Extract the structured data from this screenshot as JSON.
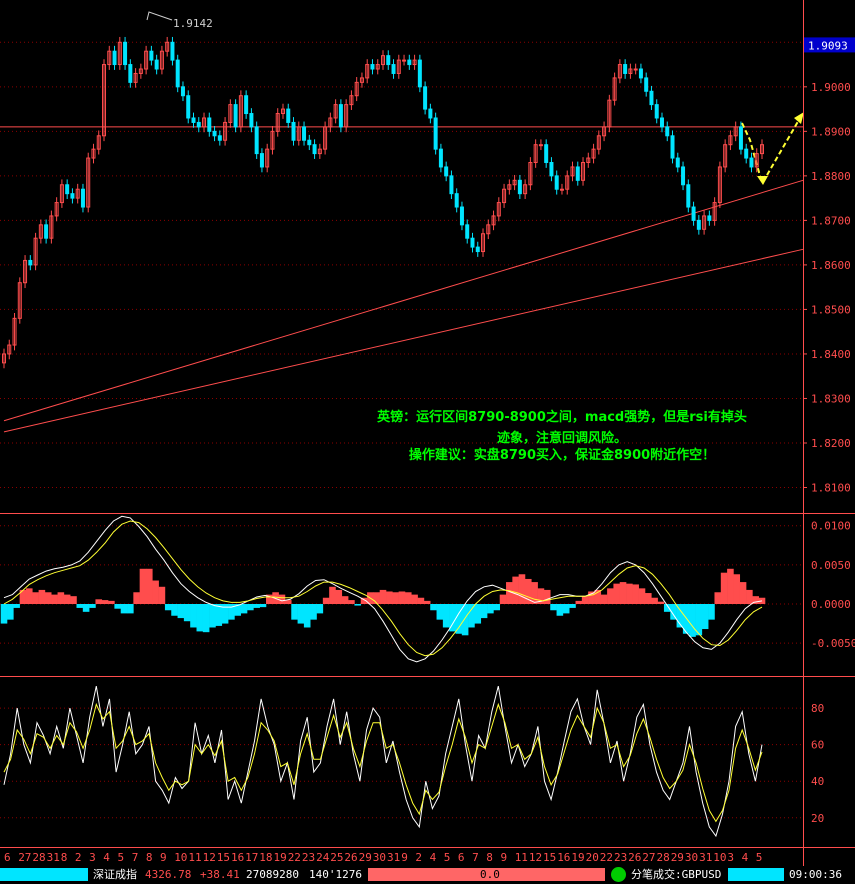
{
  "chart_data": [
    {
      "type": "candlestick",
      "symbol": "GBPUSD",
      "ylim": [
        1.8045,
        1.9195
      ],
      "y_ticks": [
        "1.9100",
        "1.9000",
        "1.8900",
        "1.8800",
        "1.8700",
        "1.8600",
        "1.8500",
        "1.8400",
        "1.8300",
        "1.8200",
        "1.8100"
      ],
      "last_price": "1.9093",
      "peak_label": "1.9142",
      "horizontal_line": 1.891,
      "trendlines": [
        {
          "from": [
            0,
            1.825
          ],
          "to": [
            160,
            1.879
          ]
        },
        {
          "from": [
            0,
            1.8225
          ],
          "to": [
            160,
            1.8635
          ]
        }
      ],
      "close": [
        1.84,
        1.842,
        1.848,
        1.856,
        1.861,
        1.86,
        1.866,
        1.869,
        1.866,
        1.871,
        1.874,
        1.878,
        1.876,
        1.875,
        1.877,
        1.873,
        1.884,
        1.886,
        1.889,
        1.905,
        1.908,
        1.905,
        1.91,
        1.905,
        1.901,
        1.903,
        1.904,
        1.908,
        1.906,
        1.904,
        1.908,
        1.91,
        1.906,
        1.9,
        1.898,
        1.893,
        1.892,
        1.891,
        1.893,
        1.89,
        1.889,
        1.888,
        1.892,
        1.896,
        1.891,
        1.898,
        1.894,
        1.891,
        1.885,
        1.882,
        1.886,
        1.89,
        1.894,
        1.895,
        1.892,
        1.888,
        1.891,
        1.888,
        1.887,
        1.885,
        1.886,
        1.891,
        1.893,
        1.896,
        1.891,
        1.896,
        1.898,
        1.901,
        1.902,
        1.905,
        1.904,
        1.905,
        1.907,
        1.905,
        1.903,
        1.906,
        1.906,
        1.905,
        1.906,
        1.9,
        1.895,
        1.893,
        1.886,
        1.882,
        1.88,
        1.876,
        1.873,
        1.869,
        1.866,
        1.864,
        1.863,
        1.867,
        1.869,
        1.871,
        1.874,
        1.877,
        1.878,
        1.879,
        1.876,
        1.878,
        1.883,
        1.887,
        1.887,
        1.883,
        1.88,
        1.877,
        1.877,
        1.88,
        1.882,
        1.879,
        1.883,
        1.884,
        1.886,
        1.889,
        1.891,
        1.897,
        1.902,
        1.905,
        1.903,
        1.904,
        1.904,
        1.902,
        1.899,
        1.896,
        1.893,
        1.891,
        1.889,
        1.884,
        1.882,
        1.878,
        1.873,
        1.87,
        1.868,
        1.871,
        1.87,
        1.874,
        1.882,
        1.887,
        1.889,
        1.891,
        1.886,
        1.884,
        1.882,
        1.885,
        1.887
      ],
      "macd": {
        "yticks": [
          "0.0100",
          "0.0050",
          "0.0000",
          "-0.0050"
        ],
        "ylim": [
          -0.0092,
          0.0115
        ],
        "hist": [
          -0.0025,
          -0.002,
          -0.0005,
          0.0018,
          0.002,
          0.0015,
          0.0018,
          0.0015,
          0.0012,
          0.0015,
          0.0012,
          0.001,
          -0.0005,
          -0.001,
          -0.0005,
          0.0006,
          0.0005,
          0.0004,
          -0.0006,
          -0.0012,
          -0.0012,
          0.0015,
          0.0045,
          0.0045,
          0.003,
          0.0022,
          -0.0008,
          -0.0015,
          -0.0018,
          -0.0022,
          -0.003,
          -0.0035,
          -0.0036,
          -0.003,
          -0.0028,
          -0.0025,
          -0.002,
          -0.0015,
          -0.0012,
          -0.0008,
          -0.0005,
          -0.0004,
          0.0012,
          0.0015,
          0.0012,
          0.0005,
          -0.002,
          -0.0025,
          -0.003,
          -0.002,
          -0.0012,
          0.0008,
          0.0022,
          0.0018,
          0.001,
          0.0005,
          -0.0002,
          0.0008,
          0.0015,
          0.0015,
          0.0018,
          0.0016,
          0.0015,
          0.0016,
          0.0015,
          0.0012,
          0.0008,
          0.0004,
          -0.0008,
          -0.002,
          -0.003,
          -0.0035,
          -0.0038,
          -0.004,
          -0.003,
          -0.0025,
          -0.0018,
          -0.0012,
          -0.0008,
          0.0012,
          0.0028,
          0.0035,
          0.0038,
          0.0032,
          0.0028,
          0.002,
          0.0018,
          -0.0008,
          -0.0015,
          -0.0012,
          -0.0005,
          0.0004,
          0.001,
          0.0016,
          0.0018,
          0.0012,
          0.002,
          0.0026,
          0.0028,
          0.0026,
          0.0025,
          0.002,
          0.0014,
          0.0008,
          0.0003,
          -0.001,
          -0.002,
          -0.003,
          -0.0038,
          -0.0042,
          -0.004,
          -0.0032,
          -0.002,
          0.0015,
          0.004,
          0.0045,
          0.0038,
          0.0028,
          0.0018,
          0.001,
          0.0008
        ],
        "dif": [
          0.0008,
          0.0012,
          0.0022,
          0.0032,
          0.0037,
          0.0042,
          0.0045,
          0.0047,
          0.005,
          0.0055,
          0.0066,
          0.008,
          0.0094,
          0.0106,
          0.0112,
          0.011,
          0.0099,
          0.0086,
          0.007,
          0.0056,
          0.004,
          0.0026,
          0.0016,
          0.0008,
          0.0002,
          -0.0002,
          -0.0004,
          -0.0004,
          -0.0001,
          0.0004,
          0.0009,
          0.0011,
          0.0008,
          0.0004,
          0.0006,
          0.0013,
          0.0023,
          0.003,
          0.0031,
          0.0026,
          0.002,
          0.0015,
          0.001,
          0.0004,
          -0.0006,
          -0.0022,
          -0.004,
          -0.0058,
          -0.007,
          -0.0074,
          -0.007,
          -0.006,
          -0.0046,
          -0.003,
          -0.0012,
          0.0004,
          0.0016,
          0.0022,
          0.0024,
          0.002,
          0.0016,
          0.0012,
          0.0007,
          0.0002,
          0.0004,
          0.0008,
          0.0012,
          0.0012,
          0.001,
          0.001,
          0.0014,
          0.0026,
          0.004,
          0.005,
          0.0054,
          0.005,
          0.004,
          0.0026,
          0.001,
          -0.0006,
          -0.0022,
          -0.0036,
          -0.0048,
          -0.0056,
          -0.0058,
          -0.005,
          -0.0036,
          -0.002,
          -0.0006,
          0.0002,
          0.0004
        ],
        "dea": [
          0.0,
          0.0006,
          0.0015,
          0.0025,
          0.0031,
          0.0036,
          0.004,
          0.0043,
          0.0046,
          0.0049,
          0.0056,
          0.0066,
          0.0078,
          0.0092,
          0.0102,
          0.0106,
          0.0104,
          0.0096,
          0.0085,
          0.0072,
          0.0058,
          0.0044,
          0.0032,
          0.0022,
          0.0014,
          0.0008,
          0.0004,
          0.0002,
          0.0002,
          0.0004,
          0.0007,
          0.0009,
          0.0009,
          0.0008,
          0.0008,
          0.001,
          0.0016,
          0.0023,
          0.0028,
          0.0028,
          0.0025,
          0.0021,
          0.0016,
          0.0011,
          0.0004,
          -0.0008,
          -0.0022,
          -0.0038,
          -0.0052,
          -0.0062,
          -0.0066,
          -0.0064,
          -0.0056,
          -0.0044,
          -0.003,
          -0.0014,
          0.0,
          0.001,
          0.0016,
          0.0018,
          0.0017,
          0.0014,
          0.001,
          0.0006,
          0.0004,
          0.0006,
          0.0008,
          0.001,
          0.001,
          0.001,
          0.0012,
          0.0018,
          0.0028,
          0.0038,
          0.0046,
          0.0049,
          0.0046,
          0.0038,
          0.0026,
          0.0012,
          -0.0004,
          -0.0018,
          -0.0032,
          -0.0044,
          -0.0052,
          -0.0053,
          -0.0046,
          -0.0034,
          -0.002,
          -0.001,
          -0.0004
        ]
      },
      "rsi": {
        "yticks": [
          "80",
          "60",
          "40",
          "20"
        ],
        "ylim": [
          4,
          97
        ],
        "rsi_fast": [
          38,
          55,
          80,
          60,
          50,
          72,
          65,
          55,
          70,
          58,
          80,
          65,
          50,
          75,
          92,
          70,
          85,
          45,
          60,
          78,
          55,
          60,
          70,
          40,
          35,
          28,
          42,
          36,
          40,
          72,
          55,
          65,
          50,
          68,
          30,
          40,
          28,
          45,
          62,
          85,
          70,
          60,
          40,
          50,
          30,
          62,
          75,
          45,
          50,
          70,
          85,
          60,
          78,
          55,
          40,
          68,
          80,
          75,
          50,
          62,
          45,
          30,
          20,
          15,
          40,
          25,
          32,
          55,
          70,
          85,
          60,
          40,
          65,
          58,
          78,
          92,
          70,
          50,
          60,
          48,
          55,
          70,
          40,
          30,
          45,
          62,
          78,
          85,
          70,
          60,
          90,
          72,
          50,
          62,
          40,
          55,
          75,
          82,
          60,
          45,
          35,
          30,
          40,
          50,
          70,
          45,
          28,
          15,
          10,
          22,
          40,
          70,
          78,
          55,
          40,
          60
        ],
        "rsi_slow": [
          45,
          52,
          68,
          63,
          55,
          66,
          64,
          58,
          65,
          60,
          72,
          67,
          58,
          68,
          82,
          74,
          78,
          58,
          62,
          70,
          60,
          62,
          66,
          50,
          42,
          35,
          40,
          38,
          40,
          60,
          55,
          60,
          54,
          62,
          40,
          42,
          35,
          42,
          55,
          72,
          68,
          62,
          48,
          50,
          38,
          55,
          66,
          52,
          52,
          64,
          76,
          64,
          72,
          58,
          48,
          62,
          72,
          72,
          58,
          60,
          50,
          38,
          28,
          22,
          35,
          30,
          34,
          48,
          60,
          74,
          64,
          50,
          60,
          58,
          70,
          82,
          72,
          58,
          60,
          52,
          55,
          64,
          48,
          38,
          44,
          56,
          68,
          76,
          70,
          64,
          80,
          72,
          58,
          60,
          48,
          54,
          66,
          74,
          64,
          52,
          42,
          36,
          40,
          46,
          60,
          50,
          36,
          24,
          18,
          24,
          35,
          58,
          68,
          58,
          46,
          56
        ]
      }
    }
  ],
  "x_labels": [
    "6",
    "27",
    "28",
    "31",
    "8",
    "2",
    "3",
    "4",
    "5",
    "7",
    "8",
    "9",
    "10",
    "11",
    "12",
    "15",
    "16",
    "17",
    "18",
    "19",
    "22",
    "23",
    "24",
    "25",
    "26",
    "29",
    "30",
    "31",
    "9",
    "2",
    "4",
    "5",
    "6",
    "7",
    "8",
    "9",
    "11",
    "12",
    "15",
    "16",
    "19",
    "20",
    "22",
    "23",
    "26",
    "27",
    "28",
    "29",
    "30",
    "31",
    "10",
    "3",
    "4",
    "5"
  ],
  "annotation": {
    "line1": "英镑：运行区间8790-8900之间，macd强势，但是rsi有掉头",
    "line2": "迹象，注意回调风险。",
    "line3": "操作建议：实盘8790买入，保证金8900附近作空！"
  },
  "status_bar": {
    "index_name": "深证成指",
    "index_value": "4326.78",
    "index_change": "+38.41",
    "volume": "27089280",
    "amount": "140'1276",
    "center_value": "0.0",
    "tick_label": "分笔成交:GBPUSD",
    "clock": "09:00:36"
  },
  "colors": {
    "up": "#ff4d4d",
    "down": "#00e5ff",
    "grid": "#8b0000",
    "axis": "#ff4d4d",
    "annotation": "#00ff00",
    "last_price_bg": "#0000cc",
    "yellow": "#ffff33"
  }
}
